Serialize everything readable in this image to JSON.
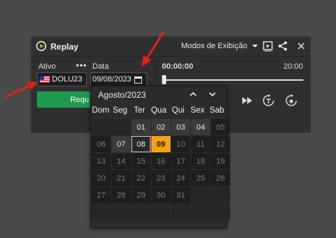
{
  "panel": {
    "title": "Replay",
    "modes_label": "Modos de Exibição",
    "asset_label": "Ativo",
    "more_label": "•••",
    "asset_value": "DOLU23",
    "date_label": "Data",
    "date_value": "09/08/2023",
    "request_button_label": "Requ",
    "time_start": "00:00:00",
    "time_end": "20:00",
    "progress_fraction": 0.0
  },
  "calendar": {
    "month_title": "Agosto/2023",
    "weekdays": [
      "Dom",
      "Seg",
      "Ter",
      "Qua",
      "Qui",
      "Sex",
      "Sab"
    ],
    "rows": [
      [
        {
          "label": "",
          "state": "empty"
        },
        {
          "label": "",
          "state": "empty"
        },
        {
          "label": "01",
          "state": "enabled"
        },
        {
          "label": "02",
          "state": "enabled"
        },
        {
          "label": "03",
          "state": "enabled"
        },
        {
          "label": "04",
          "state": "enabled"
        },
        {
          "label": "05",
          "state": "disabled"
        }
      ],
      [
        {
          "label": "06",
          "state": "disabled"
        },
        {
          "label": "07",
          "state": "enabled"
        },
        {
          "label": "08",
          "state": "outlined"
        },
        {
          "label": "09",
          "state": "selected"
        },
        {
          "label": "10",
          "state": "disabled"
        },
        {
          "label": "11",
          "state": "disabled"
        },
        {
          "label": "12",
          "state": "disabled"
        }
      ],
      [
        {
          "label": "13",
          "state": "disabled"
        },
        {
          "label": "14",
          "state": "disabled"
        },
        {
          "label": "15",
          "state": "disabled"
        },
        {
          "label": "16",
          "state": "disabled"
        },
        {
          "label": "17",
          "state": "disabled"
        },
        {
          "label": "18",
          "state": "disabled"
        },
        {
          "label": "19",
          "state": "disabled"
        }
      ],
      [
        {
          "label": "20",
          "state": "disabled"
        },
        {
          "label": "21",
          "state": "disabled"
        },
        {
          "label": "22",
          "state": "disabled"
        },
        {
          "label": "23",
          "state": "disabled"
        },
        {
          "label": "24",
          "state": "disabled"
        },
        {
          "label": "25",
          "state": "disabled"
        },
        {
          "label": "26",
          "state": "disabled"
        }
      ],
      [
        {
          "label": "27",
          "state": "disabled"
        },
        {
          "label": "28",
          "state": "disabled"
        },
        {
          "label": "29",
          "state": "disabled"
        },
        {
          "label": "30",
          "state": "disabled"
        },
        {
          "label": "31",
          "state": "disabled"
        },
        {
          "label": "",
          "state": "empty"
        },
        {
          "label": "",
          "state": "empty"
        }
      ],
      [
        {
          "label": "",
          "state": "empty"
        },
        {
          "label": "",
          "state": "empty"
        },
        {
          "label": "",
          "state": "empty"
        },
        {
          "label": "",
          "state": "empty"
        },
        {
          "label": "",
          "state": "empty"
        },
        {
          "label": "",
          "state": "empty"
        },
        {
          "label": "",
          "state": "empty"
        }
      ]
    ]
  },
  "icons": [
    "replay-icon",
    "display-mode-icon",
    "share-icon",
    "close-icon",
    "us-flag-icon",
    "calendar-icon",
    "chevron-up-icon",
    "chevron-down-icon",
    "fast-forward-icon",
    "step-icon",
    "speed-icon",
    "red-arrow-icon"
  ],
  "colors": {
    "accent_green": "#1e9a4e",
    "selected_day": "#f4a21a",
    "annotation_arrow": "#e0201a"
  }
}
